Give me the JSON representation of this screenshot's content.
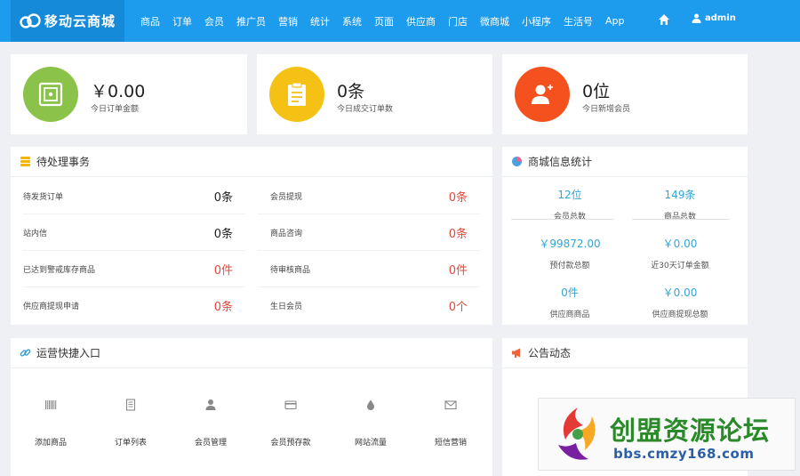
{
  "brand": {
    "title": "移动云商城"
  },
  "nav": [
    "商品",
    "订单",
    "会员",
    "推广员",
    "营销",
    "统计",
    "系统",
    "页面",
    "供应商",
    "门店",
    "微商城",
    "小程序",
    "生活号",
    "App"
  ],
  "user": {
    "name": "admin"
  },
  "stat_cards": [
    {
      "value": "￥0.00",
      "label": "今日订单金额",
      "color": "#8bc34a",
      "icon": "safe-icon"
    },
    {
      "value": "0条",
      "label": "今日成交订单数",
      "color": "#f5c114",
      "icon": "clipboard-icon"
    },
    {
      "value": "0位",
      "label": "今日新增会员",
      "color": "#f4511e",
      "icon": "add-user-icon"
    }
  ],
  "pending": {
    "title": "待处理事务",
    "left": [
      {
        "label": "待发货订单",
        "value": "0条",
        "highlight": false
      },
      {
        "label": "站内信",
        "value": "0条",
        "highlight": false
      },
      {
        "label": "已达到警戒库存商品",
        "value": "0件",
        "highlight": true
      },
      {
        "label": "供应商提现申请",
        "value": "0条",
        "highlight": true
      }
    ],
    "right": [
      {
        "label": "会员提现",
        "value": "0条",
        "highlight": true
      },
      {
        "label": "商品咨询",
        "value": "0条",
        "highlight": true
      },
      {
        "label": "待审核商品",
        "value": "0件",
        "highlight": true
      },
      {
        "label": "生日会员",
        "value": "0个",
        "highlight": true
      }
    ]
  },
  "store_stats": {
    "title": "商城信息统计",
    "items": [
      {
        "value": "12位",
        "label": "会员总数"
      },
      {
        "value": "149条",
        "label": "商品总数"
      },
      {
        "value": "￥99872.00",
        "label": "预付款总额"
      },
      {
        "value": "￥0.00",
        "label": "近30天订单金额"
      },
      {
        "value": "0件",
        "label": "供应商商品"
      },
      {
        "value": "￥0.00",
        "label": "供应商提现总额"
      }
    ]
  },
  "shortcuts": {
    "title": "运营快捷入口",
    "items": [
      {
        "label": "添加商品",
        "icon": "barcode-icon"
      },
      {
        "label": "订单列表",
        "icon": "document-icon"
      },
      {
        "label": "会员管理",
        "icon": "user-icon"
      },
      {
        "label": "会员预存款",
        "icon": "credit-card-icon"
      },
      {
        "label": "网站流量",
        "icon": "droplet-icon"
      },
      {
        "label": "短信营销",
        "icon": "envelope-icon"
      }
    ]
  },
  "announcements": {
    "title": "公告动态"
  },
  "watermark": {
    "text": "创盟资源论坛",
    "url": "bbs.cmzy168.com"
  },
  "colors": {
    "primary": "#1d9bec",
    "highlight": "#e04a3c",
    "stat_value": "#33a6d8"
  }
}
